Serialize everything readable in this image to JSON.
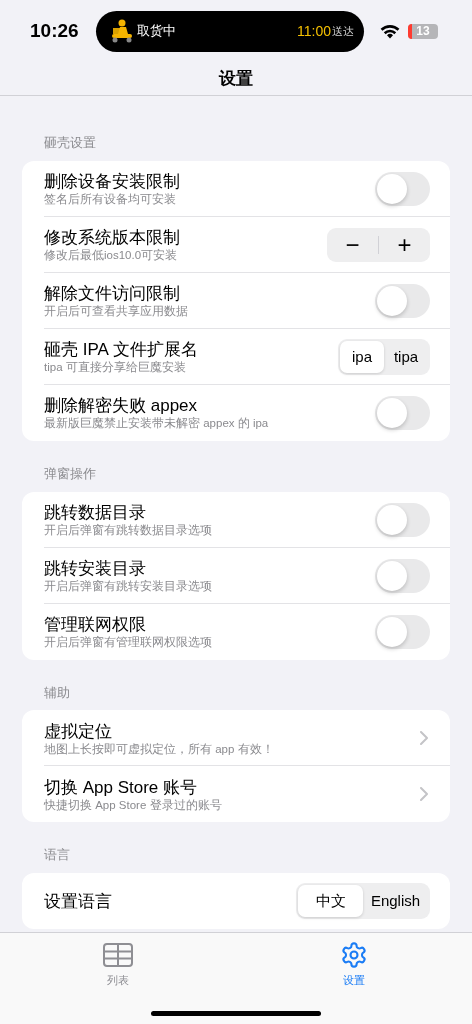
{
  "status_bar": {
    "time": "10:26",
    "activity": {
      "label": "取货中",
      "eta": "11:00",
      "eta_suffix": "送达"
    },
    "battery": "13"
  },
  "nav": {
    "title": "设置"
  },
  "sections": [
    {
      "header": "砸壳设置",
      "rows": [
        {
          "kind": "toggle",
          "title": "删除设备安装限制",
          "subtitle": "签名后所有设备均可安装",
          "on": false
        },
        {
          "kind": "stepper",
          "title": "修改系统版本限制",
          "subtitle": "修改后最低ios10.0可安装",
          "minus": "−",
          "plus": "+"
        },
        {
          "kind": "toggle",
          "title": "解除文件访问限制",
          "subtitle": "开启后可查看共享应用数据",
          "on": false
        },
        {
          "kind": "segmented",
          "title": "砸壳 IPA 文件扩展名",
          "subtitle": "tipa 可直接分享给巨魔安装",
          "options": [
            {
              "label": "ipa",
              "selected": true
            },
            {
              "label": "tipa",
              "selected": false
            }
          ]
        },
        {
          "kind": "toggle",
          "title": "删除解密失败 appex",
          "subtitle": "最新版巨魔禁止安装带未解密 appex 的 ipa",
          "on": false
        }
      ]
    },
    {
      "header": "弹窗操作",
      "rows": [
        {
          "kind": "toggle",
          "title": "跳转数据目录",
          "subtitle": "开启后弹窗有跳转数据目录选项",
          "on": false
        },
        {
          "kind": "toggle",
          "title": "跳转安装目录",
          "subtitle": "开启后弹窗有跳转安装目录选项",
          "on": false
        },
        {
          "kind": "toggle",
          "title": "管理联网权限",
          "subtitle": "开启后弹窗有管理联网权限选项",
          "on": false
        }
      ]
    },
    {
      "header": "辅助",
      "rows": [
        {
          "kind": "link",
          "title": "虚拟定位",
          "subtitle": "地图上长按即可虚拟定位，所有 app 有效！"
        },
        {
          "kind": "link",
          "title": "切换 App Store 账号",
          "subtitle": "快捷切换 App Store 登录过的账号"
        }
      ]
    },
    {
      "header": "语言",
      "rows": [
        {
          "kind": "segmented",
          "title": "设置语言",
          "options": [
            {
              "label": "中文",
              "selected": true
            },
            {
              "label": "English",
              "selected": false
            }
          ]
        }
      ]
    }
  ],
  "tab_bar": [
    {
      "label": "列表",
      "kind": "grid",
      "selected": false
    },
    {
      "label": "设置",
      "kind": "gear",
      "selected": true
    }
  ]
}
